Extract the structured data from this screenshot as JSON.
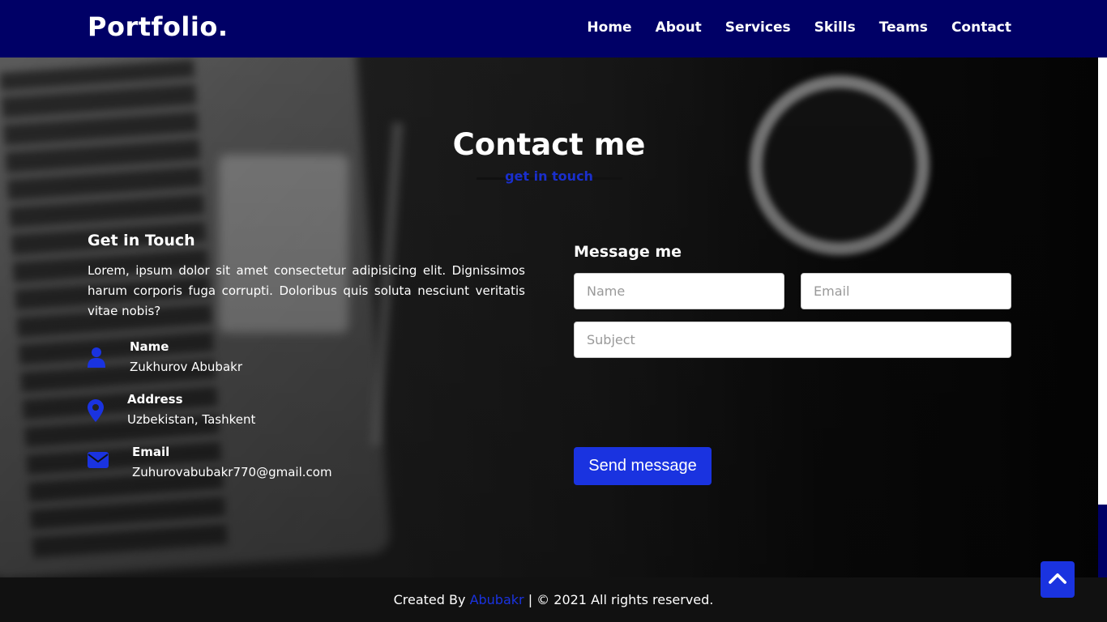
{
  "navbar": {
    "logo": "Portfolio.",
    "items": [
      {
        "label": "Home"
      },
      {
        "label": "About"
      },
      {
        "label": "Services"
      },
      {
        "label": "Skills"
      },
      {
        "label": "Teams"
      },
      {
        "label": "Contact"
      }
    ]
  },
  "contact": {
    "title": "Contact me",
    "subtitle": "get in touch",
    "left": {
      "heading": "Get in Touch",
      "text": "Lorem, ipsum dolor sit amet consectetur adipisicing elit. Dignissimos harum corporis fuga corrupti. Doloribus quis soluta nesciunt veritatis vitae nobis?",
      "info": [
        {
          "icon": "user-icon",
          "head": "Name",
          "value": "Zukhurov Abubakr"
        },
        {
          "icon": "map-marker-icon",
          "head": "Address",
          "value": "Uzbekistan, Tashkent"
        },
        {
          "icon": "envelope-icon",
          "head": "Email",
          "value": "Zuhurovabubakr770@gmail.com"
        }
      ]
    },
    "right": {
      "heading": "Message me",
      "name_placeholder": "Name",
      "email_placeholder": "Email",
      "subject_placeholder": "Subject",
      "send_label": "Send message"
    }
  },
  "footer": {
    "prefix": "Created By",
    "author": "Abubakr",
    "suffix": "| © 2021 All rights reserved."
  },
  "colors": {
    "navbar": "#000066",
    "accent": "#1a33e0",
    "footer": "#111111"
  }
}
